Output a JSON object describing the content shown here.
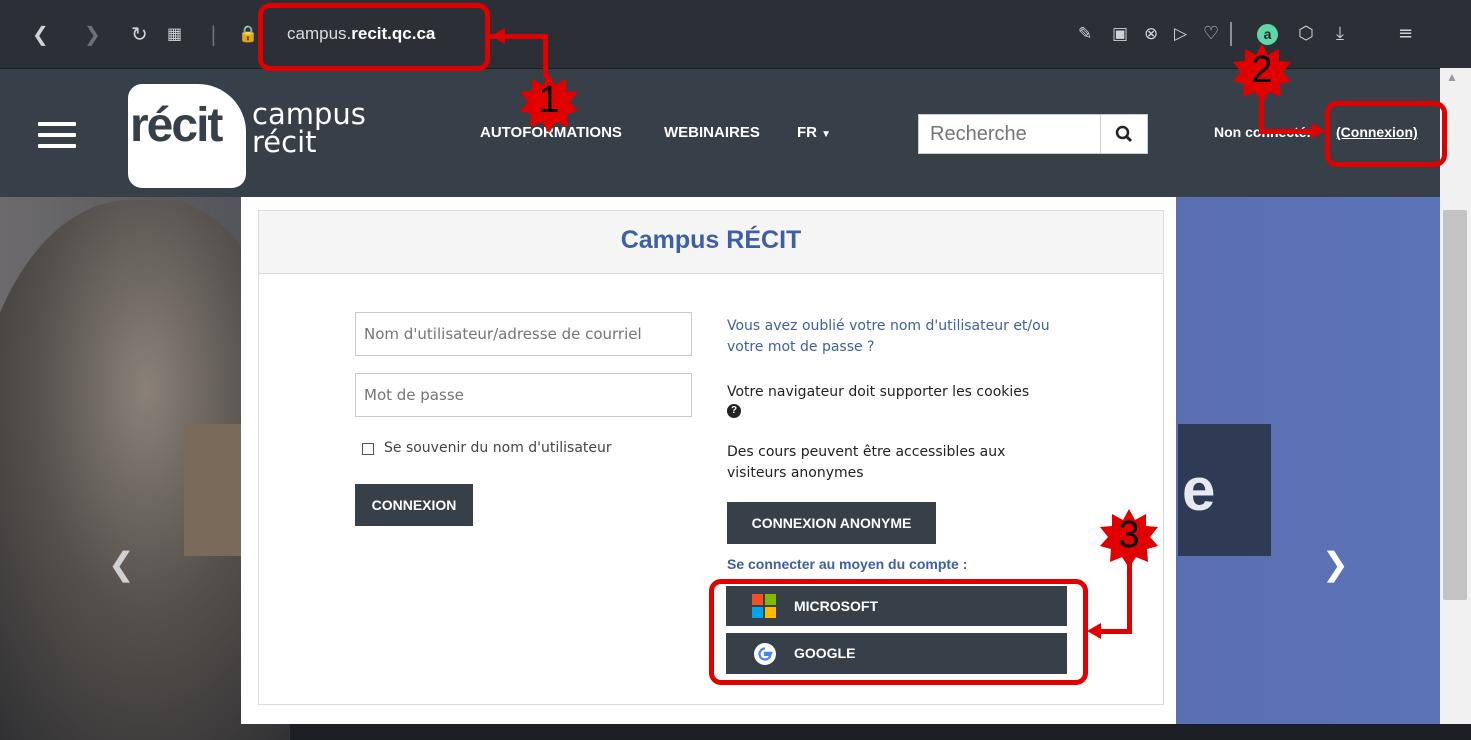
{
  "browser": {
    "url_prefix": "campus.",
    "url_domain": "recit.qc.ca",
    "icons": [
      "back-arrow",
      "forward-arrow",
      "reload",
      "speed-dial",
      "lock",
      "share",
      "camera",
      "close-circle",
      "send",
      "heart",
      "user-avatar",
      "cube",
      "download",
      "menu-lines"
    ],
    "avatar_letter": "a"
  },
  "site": {
    "logo_mark": "récit",
    "logo_line1": "campus",
    "logo_line2": "récit",
    "nav": {
      "autoformations": "AUTOFORMATIONS",
      "webinaires": "WEBINAIRES",
      "language": "FR"
    },
    "search_placeholder": "Recherche",
    "not_connected": "Non connecté.",
    "connexion_link": "(Connexion)"
  },
  "login": {
    "title": "Campus RÉCIT",
    "username_placeholder": "Nom d'utilisateur/adresse de courriel",
    "password_placeholder": "Mot de passe",
    "remember_label": "Se souvenir du nom d'utilisateur",
    "connexion_button": "CONNEXION",
    "forgot_link": "Vous avez oublié votre nom d'utilisateur et/ou votre mot de passe ?",
    "cookies_text": "Votre navigateur doit supporter les cookies",
    "anon_text": "Des cours peuvent être accessibles aux visiteurs anonymes",
    "anon_button": "CONNEXION ANONYME",
    "connect_with": "Se connecter au moyen du compte :",
    "providers": [
      {
        "label": "MICROSOFT",
        "icon": "microsoft-icon"
      },
      {
        "label": "GOOGLE",
        "icon": "google-icon"
      }
    ]
  },
  "hero": {
    "letter": "e"
  },
  "annotations": {
    "badge1": "1",
    "badge2": "2",
    "badge3": "3",
    "color": "#e00000"
  }
}
